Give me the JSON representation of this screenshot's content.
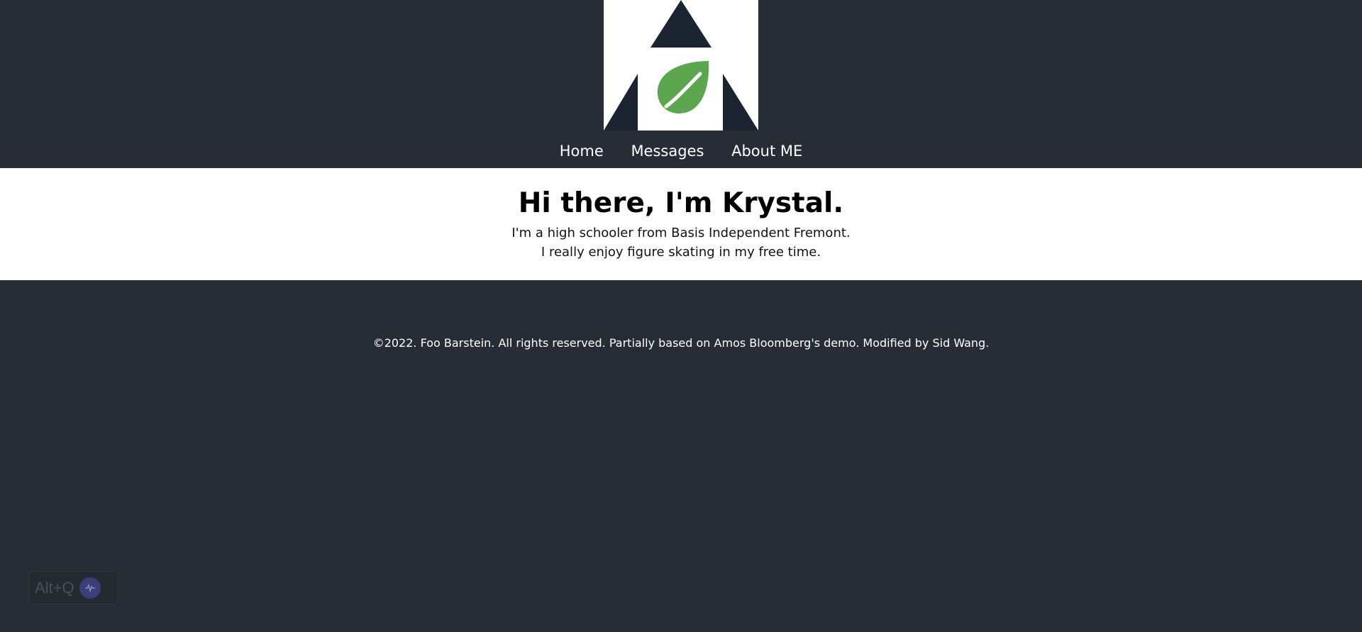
{
  "header": {
    "logo_name": "logo-icon",
    "nav": [
      {
        "label": "Home"
      },
      {
        "label": "Messages"
      },
      {
        "label": "About ME"
      }
    ]
  },
  "main": {
    "heading": "Hi there, I'm Krystal.",
    "line1": "I'm a high schooler from Basis Independent Fremont.",
    "line2": "I really enjoy figure skating in my free time."
  },
  "footer": {
    "copyright": "©2022. Foo Barstein. All rights reserved. Partially based on Amos Bloomberg's demo. Modified by Sid Wang."
  },
  "widget": {
    "shortcut_label": "Alt+Q",
    "icon": "waveform-icon"
  },
  "colors": {
    "background": "#282c34",
    "content": "#ffffff",
    "logo_dark": "#1b2430",
    "leaf_green": "#5ca64f"
  }
}
